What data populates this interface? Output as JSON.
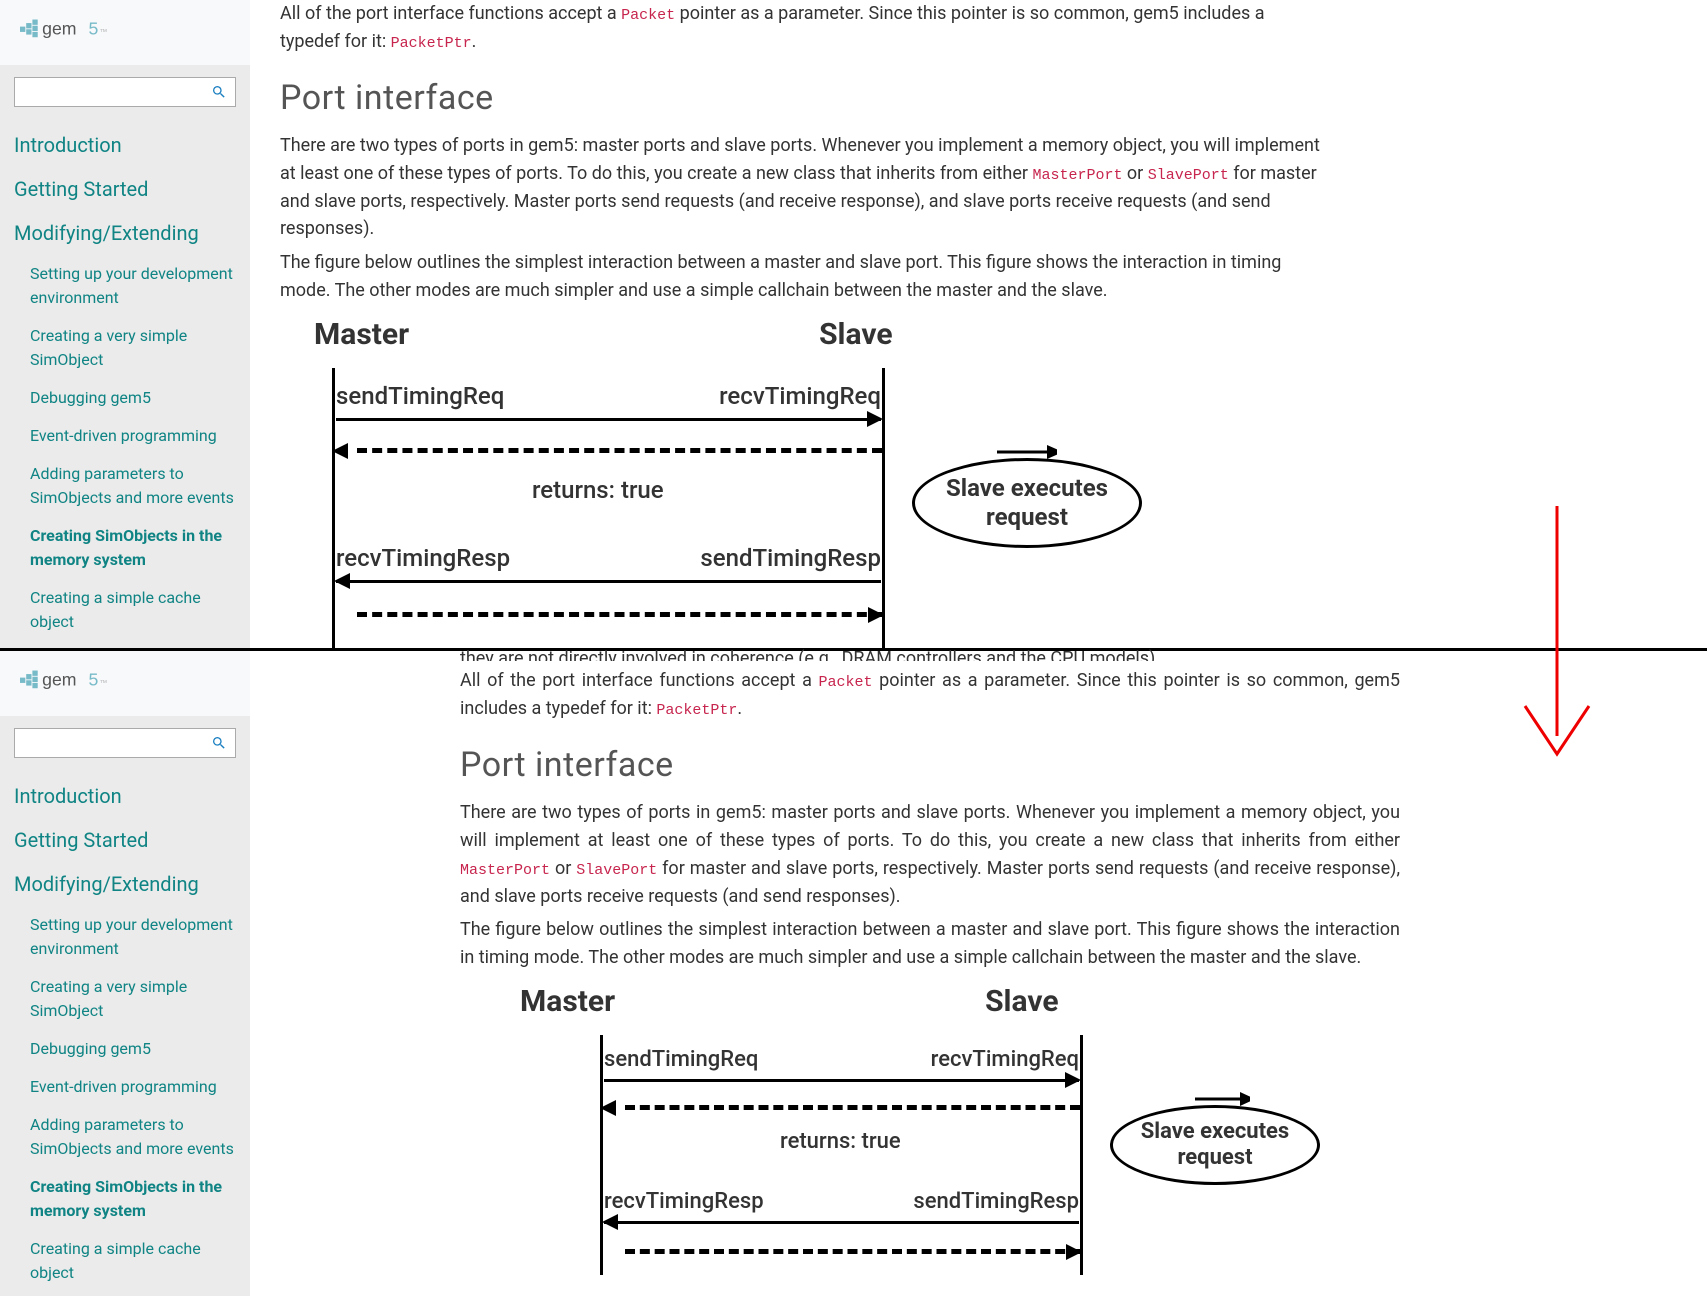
{
  "logo_text": "gem5",
  "search": {
    "placeholder": ""
  },
  "nav": {
    "sections": [
      {
        "label": "Introduction"
      },
      {
        "label": "Getting Started"
      },
      {
        "label": "Modifying/Extending"
      }
    ],
    "items": [
      {
        "label": "Setting up your development environment"
      },
      {
        "label": "Creating a very simple SimObject"
      },
      {
        "label": "Debugging gem5"
      },
      {
        "label": "Event-driven programming"
      },
      {
        "label": "Adding parameters to SimObjects and more events"
      },
      {
        "label": "Creating SimObjects in the memory system"
      },
      {
        "label": "Creating a simple cache object"
      }
    ]
  },
  "content": {
    "cutoff_line": "they are not directly involved in coherence (e.g., DRAM controllers and the CPU models).",
    "p1_a": "All of the port interface functions accept a ",
    "code_packet": "Packet",
    "p1_b": " pointer as a parameter. Since this pointer is so common, gem5 includes a typedef for it: ",
    "code_packetptr": "PacketPtr",
    "p1_c": ".",
    "h2": "Port interface",
    "p2_a": "There are two types of ports in gem5: master ports and slave ports. Whenever you implement a memory object, you will implement at least one of these types of ports. To do this, you create a new class that inherits from either ",
    "code_mp": "MasterPort",
    "p2_b": " or ",
    "code_sp": "SlavePort",
    "p2_c": " for master and slave ports, respectively. Master ports send requests (and receive response), and slave ports receive requests (and send responses).",
    "p3": "The figure below outlines the simplest interaction between a master and slave port. This figure shows the interaction in timing mode. The other modes are much simpler and use a simple callchain between the master and the slave."
  },
  "diagram": {
    "master": "Master",
    "slave": "Slave",
    "send_req": "sendTimingReq",
    "recv_req": "recvTimingReq",
    "returns": "returns: true",
    "ellipse": "Slave executes request",
    "recv_resp": "recvTimingResp",
    "send_resp": "sendTimingResp"
  }
}
